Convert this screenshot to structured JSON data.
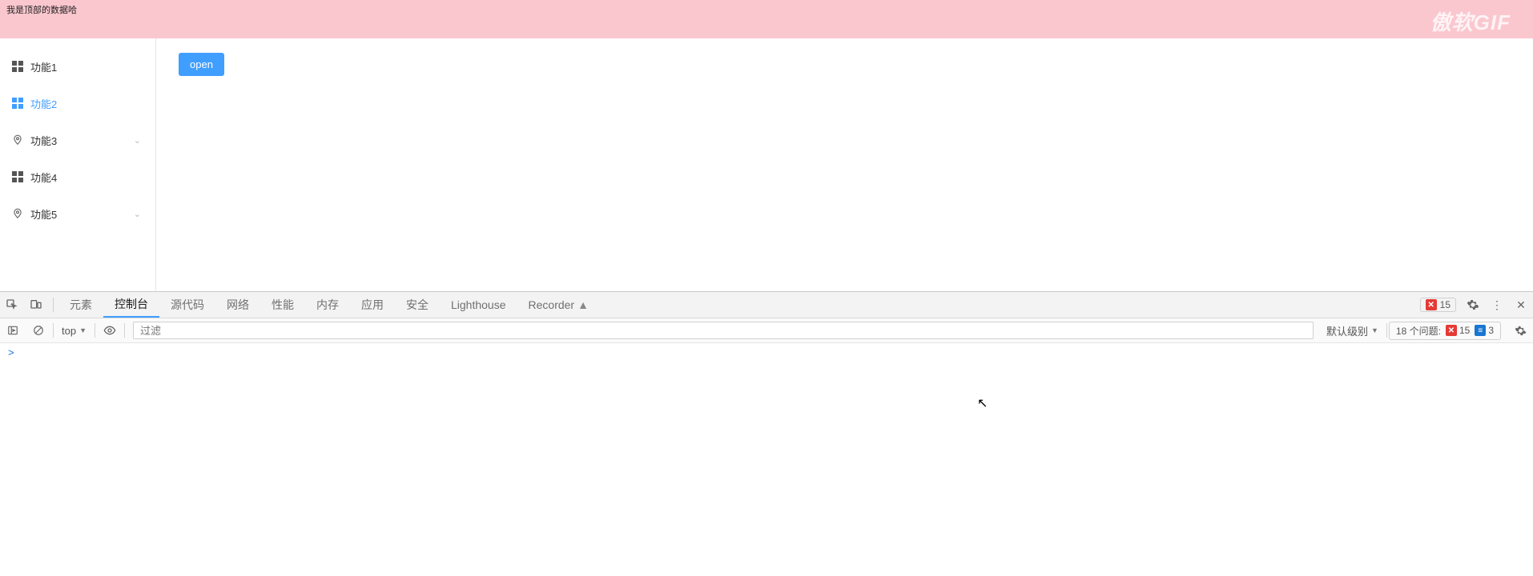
{
  "banner": {
    "text": "我是顶部的数据哈",
    "watermark": "傲软GIF"
  },
  "sidebar": {
    "items": [
      {
        "label": "功能1",
        "icon": "grid",
        "active": false,
        "expandable": false
      },
      {
        "label": "功能2",
        "icon": "grid",
        "active": true,
        "expandable": false
      },
      {
        "label": "功能3",
        "icon": "pin",
        "active": false,
        "expandable": true
      },
      {
        "label": "功能4",
        "icon": "grid",
        "active": false,
        "expandable": false
      },
      {
        "label": "功能5",
        "icon": "pin",
        "active": false,
        "expandable": true
      }
    ]
  },
  "content": {
    "open_button": "open"
  },
  "devtools": {
    "tabs": {
      "elements": "元素",
      "console": "控制台",
      "sources": "源代码",
      "network": "网络",
      "performance": "性能",
      "memory": "内存",
      "application": "应用",
      "security": "安全",
      "lighthouse": "Lighthouse",
      "recorder": "Recorder"
    },
    "active_tab": "console",
    "error_count": "15"
  },
  "console_toolbar": {
    "context": "top",
    "filter_placeholder": "过滤",
    "level_label": "默认级别",
    "issues_label": "18 个问题:",
    "issues_err": "15",
    "issues_info": "3"
  },
  "console_prompt": ">"
}
